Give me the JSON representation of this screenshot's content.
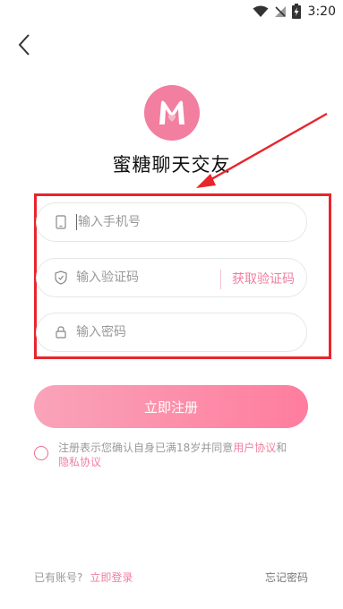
{
  "status_bar": {
    "time": "3:20"
  },
  "app": {
    "title": "蜜糖聊天交友",
    "logo_letter": "M"
  },
  "form": {
    "phone_placeholder": "输入手机号",
    "code_placeholder": "输入验证码",
    "get_code_label": "获取验证码",
    "password_placeholder": "输入密码"
  },
  "register_button": "立即注册",
  "agreement": {
    "prefix": "注册表示您确认自身已满18岁并同意",
    "user_agreement": "用户协议",
    "and": "和",
    "privacy_policy": "隐私协议"
  },
  "footer": {
    "have_account": "已有账号?",
    "login_now": "立即登录",
    "forgot_password": "忘记密码"
  },
  "colors": {
    "accent": "#f07f9f",
    "logo_bg": "#f27ea0",
    "annotation": "#e8252b"
  }
}
